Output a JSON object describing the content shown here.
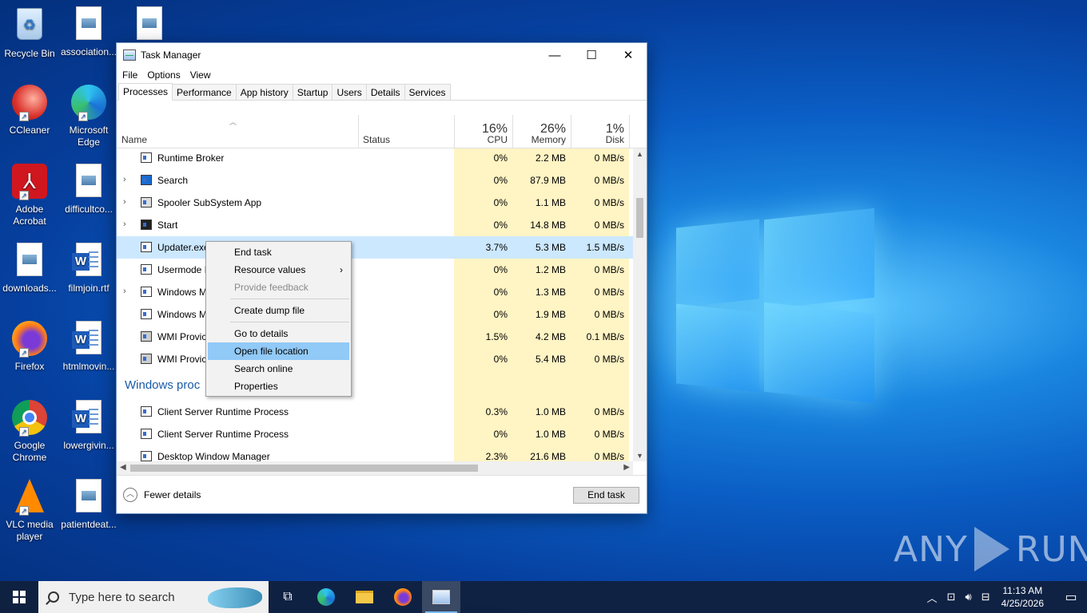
{
  "desktop": {
    "icons": [
      {
        "label": "Recycle Bin"
      },
      {
        "label": "association..."
      },
      {
        "label": ""
      },
      {
        "label": "CCleaner"
      },
      {
        "label": "Microsoft Edge"
      },
      {
        "label": "Adobe Acrobat"
      },
      {
        "label": "difficultco..."
      },
      {
        "label": "downloads..."
      },
      {
        "label": "filmjoin.rtf"
      },
      {
        "label": "Firefox"
      },
      {
        "label": "htmlmovin..."
      },
      {
        "label": "Google Chrome"
      },
      {
        "label": "lowergivin..."
      },
      {
        "label": "VLC media player"
      },
      {
        "label": "patientdeat..."
      }
    ]
  },
  "task_manager": {
    "title": "Task Manager",
    "window_controls": {
      "minimize": "—",
      "maximize": "☐",
      "close": "✕"
    },
    "menu": [
      "File",
      "Options",
      "View"
    ],
    "tabs": [
      "Processes",
      "Performance",
      "App history",
      "Startup",
      "Users",
      "Details",
      "Services"
    ],
    "columns": {
      "name": "Name",
      "status": "Status",
      "cpu": {
        "percent": "16%",
        "label": "CPU"
      },
      "memory": {
        "percent": "26%",
        "label": "Memory"
      },
      "disk": {
        "percent": "1%",
        "label": "Disk"
      }
    },
    "rows": [
      {
        "name": "Runtime Broker",
        "expand": "",
        "cpu": "0%",
        "mem": "2.2 MB",
        "disk": "0 MB/s"
      },
      {
        "name": "Search",
        "expand": "›",
        "cpu": "0%",
        "mem": "87.9 MB",
        "disk": "0 MB/s"
      },
      {
        "name": "Spooler SubSystem App",
        "expand": "›",
        "cpu": "0%",
        "mem": "1.1 MB",
        "disk": "0 MB/s"
      },
      {
        "name": "Start",
        "expand": "›",
        "cpu": "0%",
        "mem": "14.8 MB",
        "disk": "0 MB/s"
      },
      {
        "name": "Updater.exe",
        "expand": "",
        "cpu": "3.7%",
        "mem": "5.3 MB",
        "disk": "1.5 MB/s"
      },
      {
        "name": "Usermode F",
        "expand": "",
        "cpu": "0%",
        "mem": "1.2 MB",
        "disk": "0 MB/s"
      },
      {
        "name": "Windows M",
        "expand": "›",
        "cpu": "0%",
        "mem": "1.3 MB",
        "disk": "0 MB/s"
      },
      {
        "name": "Windows M",
        "expand": "",
        "cpu": "0%",
        "mem": "1.9 MB",
        "disk": "0 MB/s"
      },
      {
        "name": "WMI Provic",
        "expand": "",
        "cpu": "1.5%",
        "mem": "4.2 MB",
        "disk": "0.1 MB/s"
      },
      {
        "name": "WMI Provic",
        "expand": "",
        "cpu": "0%",
        "mem": "5.4 MB",
        "disk": "0 MB/s"
      }
    ],
    "group_label": "Windows proc",
    "rows2": [
      {
        "name": "Client Server Runtime Process",
        "cpu": "0.3%",
        "mem": "1.0 MB",
        "disk": "0 MB/s"
      },
      {
        "name": "Client Server Runtime Process",
        "cpu": "0%",
        "mem": "1.0 MB",
        "disk": "0 MB/s"
      },
      {
        "name": "Desktop Window Manager",
        "cpu": "2.3%",
        "mem": "21.6 MB",
        "disk": "0 MB/s"
      }
    ],
    "fewer_details": "Fewer details",
    "end_task": "End task"
  },
  "context_menu": {
    "items": [
      {
        "label": "End task"
      },
      {
        "label": "Resource values",
        "submenu": "›"
      },
      {
        "label": "Provide feedback"
      },
      {
        "label": "Create dump file"
      },
      {
        "label": "Go to details"
      },
      {
        "label": "Open file location"
      },
      {
        "label": "Search online"
      },
      {
        "label": "Properties"
      }
    ]
  },
  "watermark": {
    "left": "ANY",
    "right": "RUN"
  },
  "taskbar": {
    "search_placeholder": "Type here to search",
    "time": "11:13 AM",
    "date": "4/25/2026"
  }
}
